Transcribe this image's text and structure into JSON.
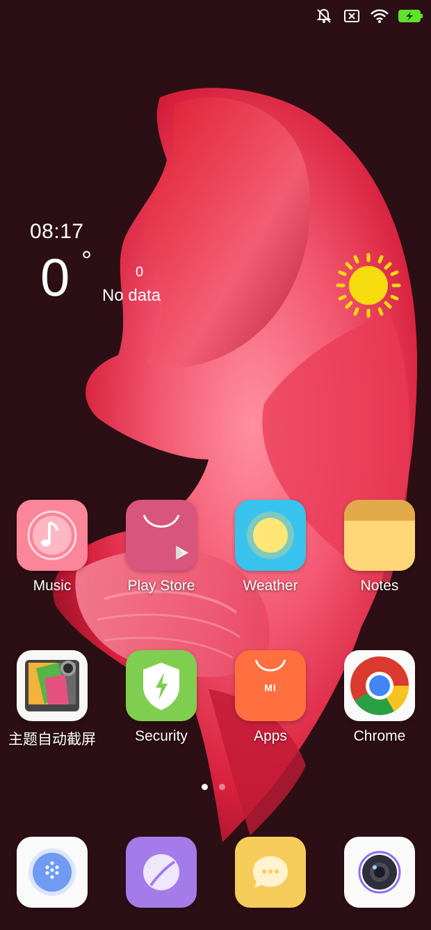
{
  "status_bar": {
    "icons": [
      "mute-icon",
      "sim-off-icon",
      "wifi-icon",
      "battery-charging-icon"
    ],
    "battery_color": "#5ee22c"
  },
  "weather_widget": {
    "time": "08:17",
    "temperature": "0",
    "degree_symbol": "°",
    "aux_value": "0",
    "status": "No data",
    "icon": "sun-icon"
  },
  "apps_row1": [
    {
      "label": "Music",
      "icon": "music-icon"
    },
    {
      "label": "Play Store",
      "icon": "play-store-icon"
    },
    {
      "label": "Weather",
      "icon": "weather-icon"
    },
    {
      "label": "Notes",
      "icon": "notes-icon"
    }
  ],
  "apps_row2": [
    {
      "label": "主题自动截屏",
      "icon": "theme-screenshot-icon"
    },
    {
      "label": "Security",
      "icon": "security-icon"
    },
    {
      "label": "Apps",
      "icon": "apps-store-icon",
      "badge": "MI"
    },
    {
      "label": "Chrome",
      "icon": "chrome-icon"
    }
  ],
  "pager": {
    "pages": 2,
    "active": 1
  },
  "dock": [
    {
      "icon": "phone-dialer-icon"
    },
    {
      "icon": "browser-icon"
    },
    {
      "icon": "messaging-icon"
    },
    {
      "icon": "camera-icon"
    }
  ]
}
